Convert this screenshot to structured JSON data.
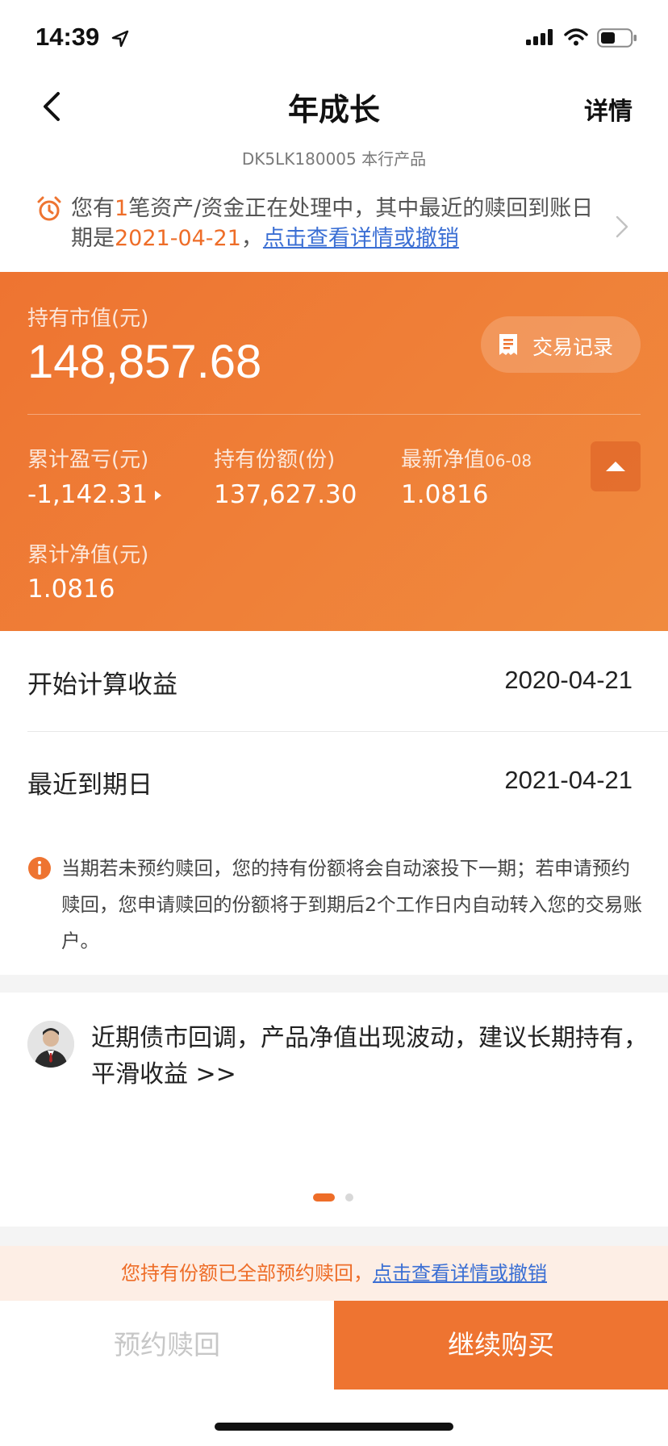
{
  "status_bar": {
    "time": "14:39",
    "icons": [
      "location-arrow-icon",
      "signal-icon",
      "wifi-icon",
      "battery-icon"
    ]
  },
  "nav": {
    "title": "年成长",
    "right_action": "详情",
    "back_icon": "chevron-left-icon"
  },
  "product_code": "DK5LK180005 本行产品",
  "notice": {
    "icon": "alarm-clock-icon",
    "text_1": "您有",
    "count": "1",
    "text_2": "笔资产/资金正在处理中，其中最近的赎回到账日期是",
    "date": "2021-04-21",
    "text_3": "，",
    "link": "点击查看详情或撤销"
  },
  "card": {
    "market_value_label": "持有市值(元)",
    "market_value": "148,857.68",
    "tx_button_label": "交易记录",
    "tx_icon": "receipt-icon",
    "profit_label": "累计盈亏(元)",
    "profit_value": "-1,142.31",
    "shares_label": "持有份额(份)",
    "shares_value": "137,627.30",
    "latest_nav_label": "最新净值",
    "latest_nav_date": "06-08",
    "latest_nav_value": "1.0816",
    "cumulative_nav_label": "累计净值(元)",
    "cumulative_nav_value": "1.0816",
    "collapse_icon": "caret-up-icon"
  },
  "rows": [
    {
      "label": "开始计算收益",
      "value": "2020-04-21"
    },
    {
      "label": "最近到期日",
      "value": "2021-04-21"
    }
  ],
  "tip": {
    "icon": "info-icon",
    "text": "当期若未预约赎回，您的持有份额将会自动滚投下一期；若申请预约赎回，您申请赎回的份额将于到期后2个工作日内自动转入您的交易账户。"
  },
  "advice": {
    "avatar": "advisor-avatar",
    "text": "近期债市回调，产品净值出现波动，建议长期持有，平滑收益 >>",
    "page": 1,
    "page_count": 2
  },
  "redeem_banner": {
    "text": "您持有份额已全部预约赎回，",
    "link": "点击查看详情或撤销"
  },
  "bottom": {
    "reserve_label": "预约赎回",
    "buy_label": "继续购买"
  },
  "colors": {
    "accent": "#ee7431",
    "link": "#3b6fd4",
    "banner_bg": "#fdeee5"
  }
}
